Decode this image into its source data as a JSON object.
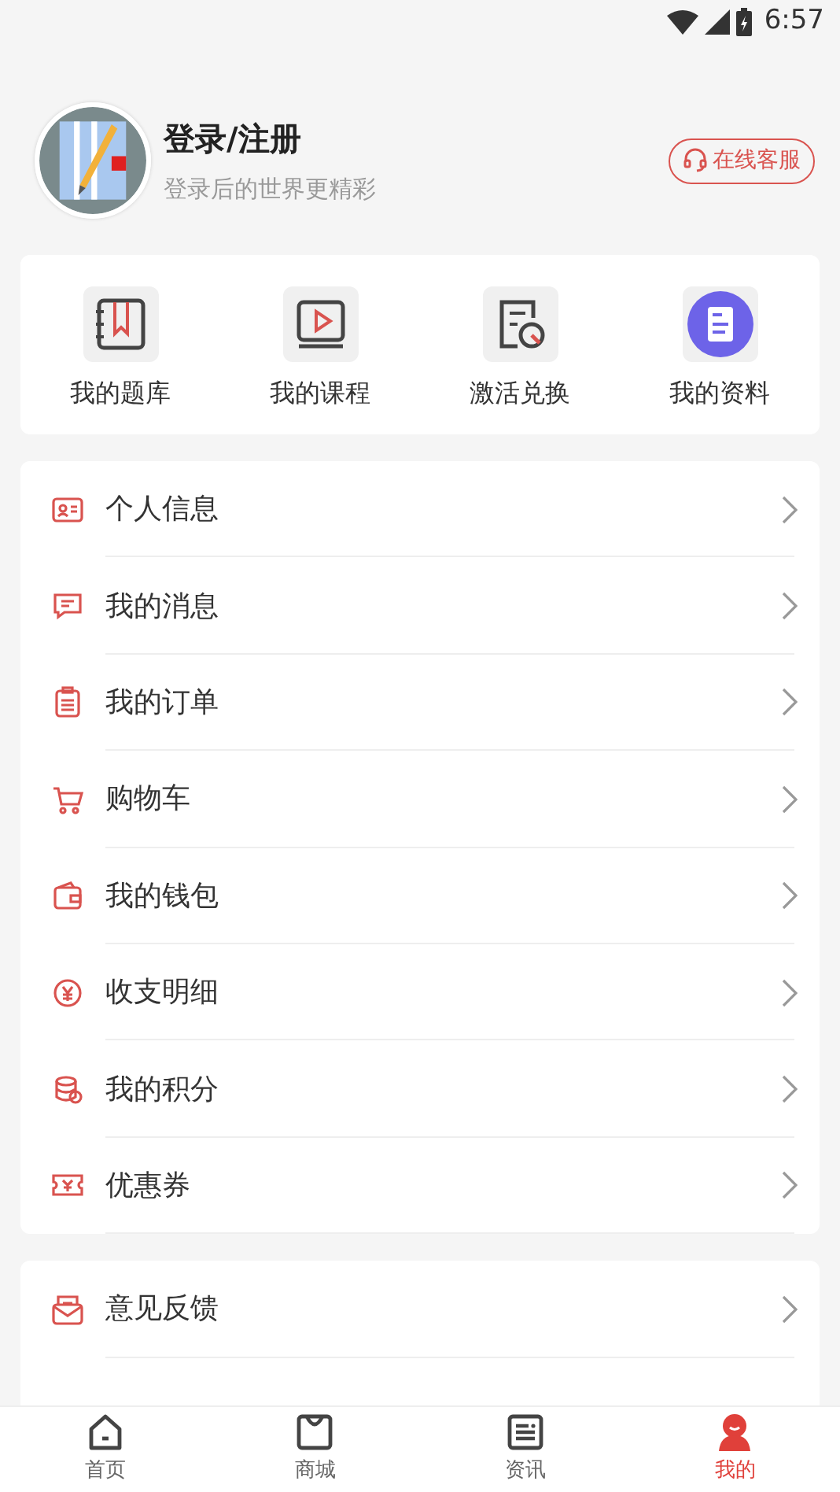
{
  "status_bar": {
    "time": "6:57"
  },
  "profile": {
    "title": "登录/注册",
    "subtitle": "登录后的世界更精彩",
    "service_button": "在线客服"
  },
  "shortcuts": [
    {
      "label": "我的题库"
    },
    {
      "label": "我的课程"
    },
    {
      "label": "激活兑换"
    },
    {
      "label": "我的资料"
    }
  ],
  "menu_groups": [
    [
      {
        "label": "个人信息"
      },
      {
        "label": "我的消息"
      },
      {
        "label": "我的订单"
      },
      {
        "label": "购物车"
      },
      {
        "label": "我的钱包"
      },
      {
        "label": "收支明细"
      },
      {
        "label": "我的积分"
      },
      {
        "label": "优惠券"
      }
    ],
    [
      {
        "label": "意见反馈"
      }
    ]
  ],
  "bottom_nav": [
    {
      "label": "首页",
      "selected": false
    },
    {
      "label": "商城",
      "selected": false
    },
    {
      "label": "资讯",
      "selected": false
    },
    {
      "label": "我的",
      "selected": true
    }
  ]
}
